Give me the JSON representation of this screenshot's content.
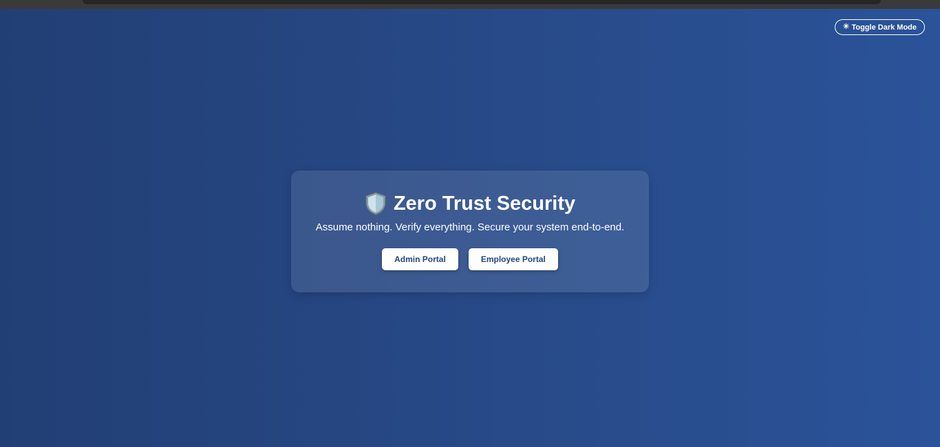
{
  "toggle": {
    "icon": "sun-icon",
    "glyph": "☀",
    "label": "Toggle Dark Mode"
  },
  "hero": {
    "icon": "shield-icon",
    "title": "Zero Trust Security",
    "subtitle": "Assume nothing. Verify everything. Secure your system end-to-end."
  },
  "buttons": {
    "admin_label": "Admin Portal",
    "employee_label": "Employee Portal"
  },
  "colors": {
    "background_start": "#223f75",
    "background_end": "#2b5399",
    "button_text": "#234580",
    "text": "#ffffff"
  }
}
